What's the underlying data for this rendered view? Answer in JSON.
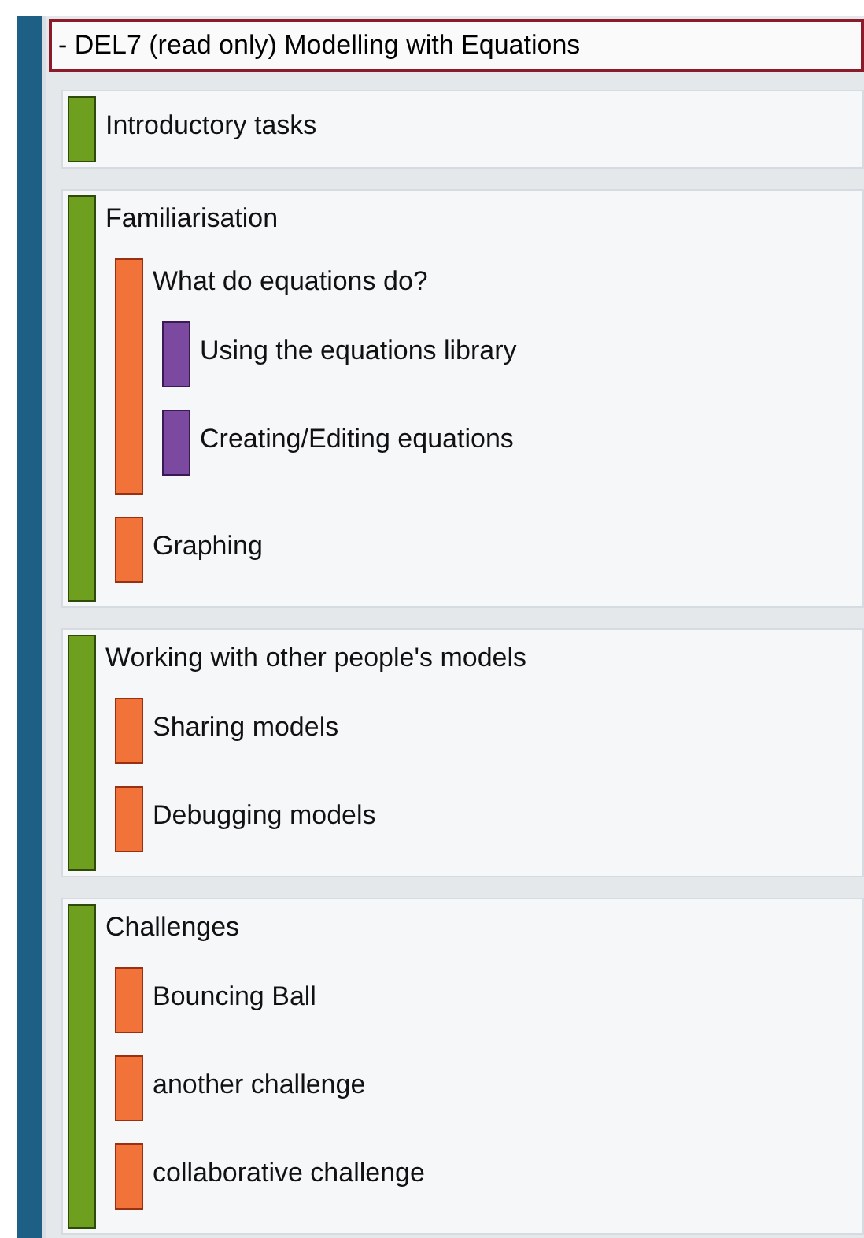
{
  "header": {
    "title": "- DEL7 (read only) Modelling with Equations"
  },
  "items": [
    {
      "label": "Introductory tasks"
    },
    {
      "label": "Familiarisation",
      "children": [
        {
          "label": "What do equations do?",
          "children": [
            {
              "label": "Using the equations library"
            },
            {
              "label": "Creating/Editing equations"
            }
          ]
        },
        {
          "label": "Graphing"
        }
      ]
    },
    {
      "label": "Working with other people's models",
      "children": [
        {
          "label": "Sharing models"
        },
        {
          "label": "Debugging models"
        }
      ]
    },
    {
      "label": "Challenges",
      "children": [
        {
          "label": "Bouncing Ball"
        },
        {
          "label": "another challenge"
        },
        {
          "label": "collaborative challenge"
        }
      ]
    }
  ]
}
